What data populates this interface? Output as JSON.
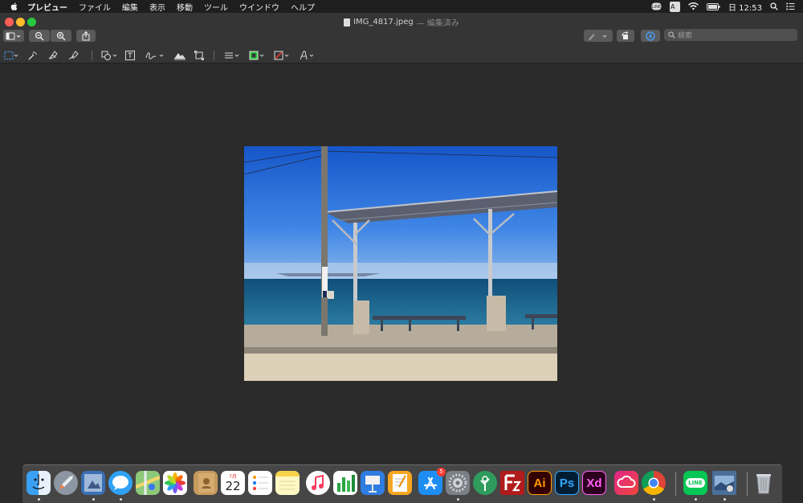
{
  "menubar": {
    "app_name": "プレビュー",
    "items": [
      "ファイル",
      "編集",
      "表示",
      "移動",
      "ツール",
      "ウインドウ",
      "ヘルプ"
    ],
    "input_source": "A",
    "clock": "日 12:53"
  },
  "window": {
    "filename": "IMG_4817.jpeg",
    "edited_suffix": "— 編集済み",
    "search_placeholder": "検索"
  },
  "dock": {
    "calendar_month": "7月",
    "calendar_day": "22",
    "appstore_badge": "5",
    "illustrator_label": "Ai",
    "photoshop_label": "Ps",
    "xd_label": "Xd",
    "line_label": "LINE"
  }
}
